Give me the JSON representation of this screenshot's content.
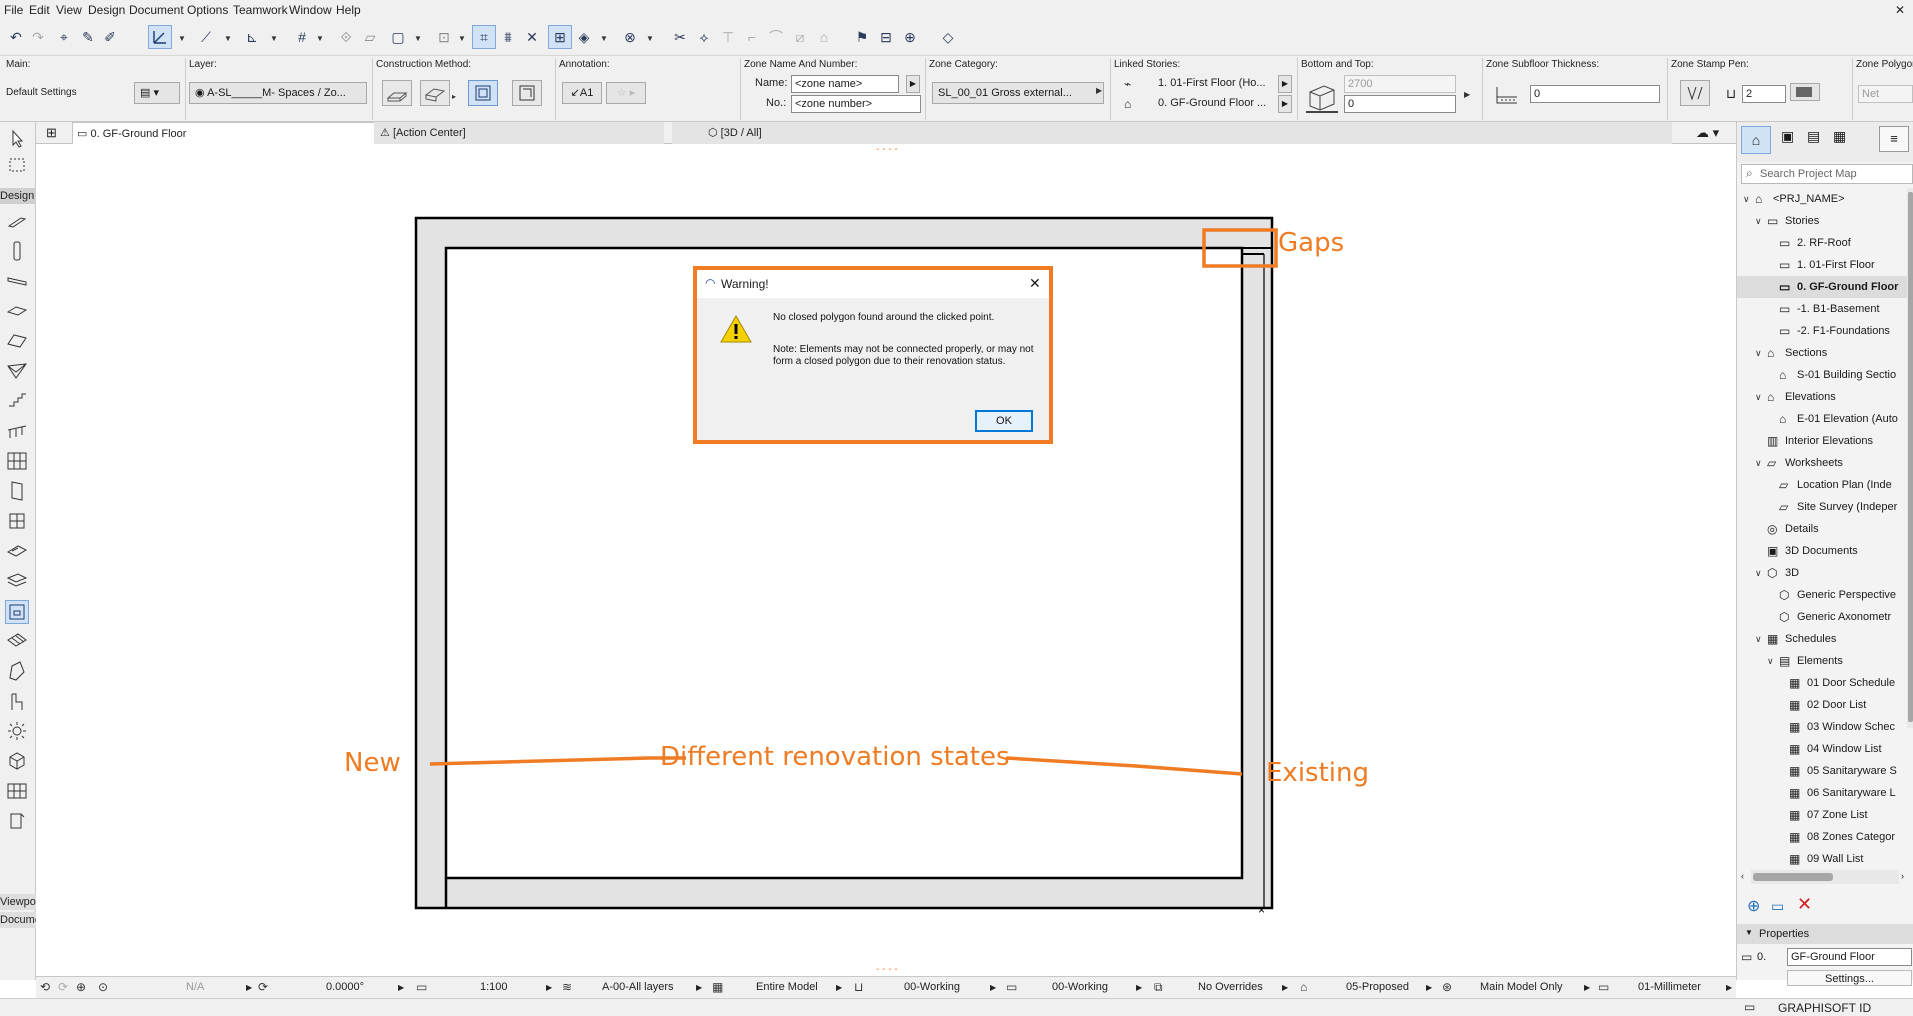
{
  "menu": [
    "File",
    "Edit",
    "View",
    "Design",
    "Document",
    "Options",
    "Teamwork",
    "Window",
    "Help"
  ],
  "info_box": {
    "main_label": "Main:",
    "default_settings": "Default Settings",
    "layer_label": "Layer:",
    "layer_value": "A-SL_____M- Spaces / Zo...",
    "construction_label": "Construction Method:",
    "annotation_label": "Annotation:",
    "annotation_value": "A1",
    "zone_name_label": "Zone Name And Number:",
    "name_label": "Name:",
    "name_value": "<zone name>",
    "no_label": "No.:",
    "no_value": "<zone number>",
    "zone_category_label": "Zone Category:",
    "zone_category_value": "SL_00_01 Gross external...",
    "linked_stories_label": "Linked Stories:",
    "linked_top": "1. 01-First Floor (Ho...",
    "linked_bottom": "0. GF-Ground Floor ...",
    "bottom_top_label": "Bottom and Top:",
    "top_value": "2700",
    "bottom_value": "0",
    "subfloor_label": "Zone Subfloor Thickness:",
    "subfloor_value": "0",
    "stamp_pen_label": "Zone Stamp Pen:",
    "stamp_pen_value": "2",
    "polygon_label": "Zone Polygon A",
    "polygon_value": "Net"
  },
  "tabs": [
    {
      "label": "0. GF-Ground Floor",
      "close": "×"
    },
    {
      "label": "[Action Center]"
    },
    {
      "label": "[3D / All]"
    }
  ],
  "toolbox": {
    "design_label": "Design",
    "viewpoint_label": "Viewpoi",
    "document_label": "Docume"
  },
  "navigator": {
    "search_placeholder": "Search Project Map",
    "tree": [
      {
        "label": "<PRJ_NAME>",
        "level": 0,
        "expander": "∨",
        "icon": "project-icon"
      },
      {
        "label": "Stories",
        "level": 1,
        "expander": "∨",
        "icon": "stories-icon"
      },
      {
        "label": "2. RF-Roof",
        "level": 2,
        "icon": "story-icon"
      },
      {
        "label": "1. 01-First Floor",
        "level": 2,
        "icon": "story-icon"
      },
      {
        "label": "0. GF-Ground Floor",
        "level": 2,
        "icon": "story-icon",
        "selected": true
      },
      {
        "label": "-1. B1-Basement",
        "level": 2,
        "icon": "story-icon"
      },
      {
        "label": "-2. F1-Foundations",
        "level": 2,
        "icon": "story-icon"
      },
      {
        "label": "Sections",
        "level": 1,
        "expander": "∨",
        "icon": "sections-icon"
      },
      {
        "label": "S-01 Building Sectio",
        "level": 2,
        "icon": "section-icon"
      },
      {
        "label": "Elevations",
        "level": 1,
        "expander": "∨",
        "icon": "elevations-icon"
      },
      {
        "label": "E-01 Elevation (Auto",
        "level": 2,
        "icon": "elevation-icon"
      },
      {
        "label": "Interior Elevations",
        "level": 1,
        "icon": "interior-elevation-icon"
      },
      {
        "label": "Worksheets",
        "level": 1,
        "expander": "∨",
        "icon": "worksheets-icon"
      },
      {
        "label": "Location Plan (Inde",
        "level": 2,
        "icon": "worksheet-icon"
      },
      {
        "label": "Site Survey (Indeper",
        "level": 2,
        "icon": "worksheet-icon"
      },
      {
        "label": "Details",
        "level": 1,
        "icon": "details-icon"
      },
      {
        "label": "3D Documents",
        "level": 1,
        "icon": "3d-document-icon"
      },
      {
        "label": "3D",
        "level": 1,
        "expander": "∨",
        "icon": "3d-icon"
      },
      {
        "label": "Generic Perspective",
        "level": 2,
        "icon": "perspective-icon"
      },
      {
        "label": "Generic Axonometr",
        "level": 2,
        "icon": "axonometry-icon"
      },
      {
        "label": "Schedules",
        "level": 1,
        "expander": "∨",
        "icon": "schedules-icon"
      },
      {
        "label": "Elements",
        "level": 2,
        "expander": "∨",
        "icon": "elements-icon"
      },
      {
        "label": "01 Door Schedule",
        "level": 3,
        "icon": "schedule-icon"
      },
      {
        "label": "02 Door List",
        "level": 3,
        "icon": "schedule-icon"
      },
      {
        "label": "03 Window Schec",
        "level": 3,
        "icon": "schedule-icon"
      },
      {
        "label": "04 Window List",
        "level": 3,
        "icon": "schedule-icon"
      },
      {
        "label": "05 Sanitaryware S",
        "level": 3,
        "icon": "schedule-icon"
      },
      {
        "label": "06 Sanitaryware L",
        "level": 3,
        "icon": "schedule-icon"
      },
      {
        "label": "07 Zone List",
        "level": 3,
        "icon": "schedule-icon"
      },
      {
        "label": "08 Zones Categor",
        "level": 3,
        "icon": "schedule-icon"
      },
      {
        "label": "09 Wall List",
        "level": 3,
        "icon": "schedule-icon"
      }
    ],
    "properties_label": "Properties",
    "prop_id": "0.",
    "prop_value": "GF-Ground Floor",
    "settings_label": "Settings..."
  },
  "status": {
    "angle_na": "N/A",
    "angle_value": "0.0000°",
    "scale": "1:100",
    "layers": "A-00-All layers",
    "model": "Entire Model",
    "pen_set": "00-Working",
    "model_view": "00-Working",
    "overrides": "No Overrides",
    "renovation": "05-Proposed",
    "display": "Main Model Only",
    "units": "01-Millimeter"
  },
  "brand": "GRAPHISOFT ID",
  "dialog": {
    "title": "Warning!",
    "message1": "No closed polygon found around the clicked point.",
    "message2": "Note: Elements may not be connected properly, or may not form a closed polygon due to their renovation status.",
    "ok": "OK",
    "close": "✕"
  },
  "annotations": {
    "gaps": "Gaps",
    "new": "New",
    "different": "Different renovation states",
    "existing": "Existing"
  },
  "colors": {
    "accent": "#ef7b22",
    "selection": "#cfe2f6"
  }
}
